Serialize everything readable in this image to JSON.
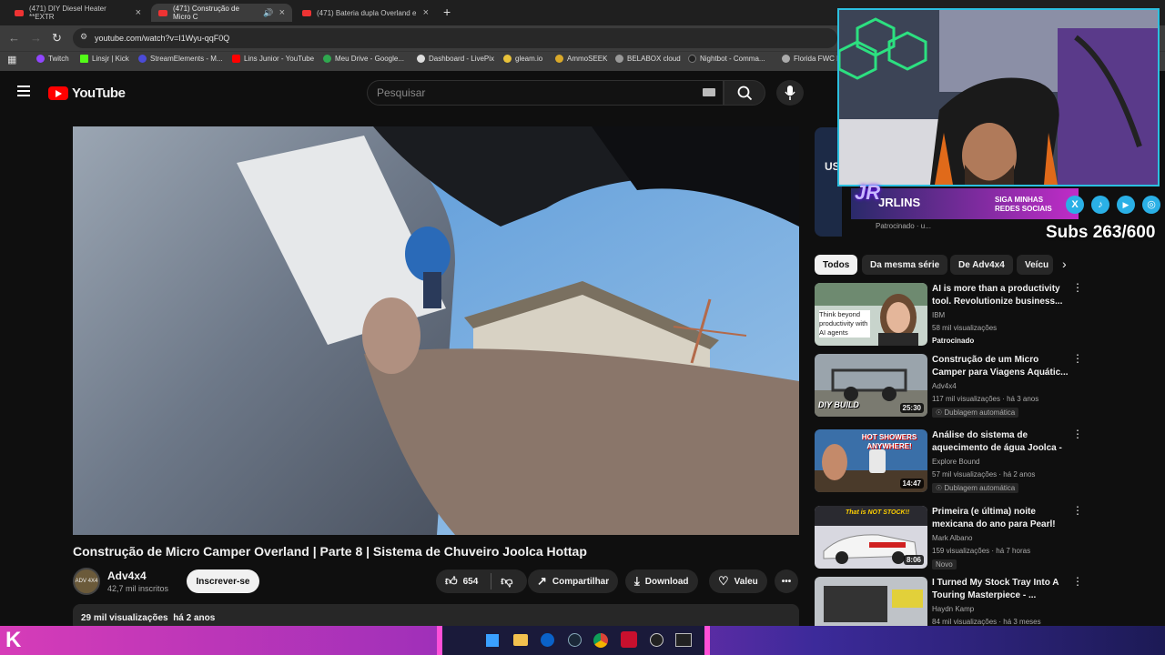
{
  "browser": {
    "tabs": [
      {
        "label": "(471) DIY Diesel Heater **EXTR",
        "active": false
      },
      {
        "label": "(471) Construção de Micro C",
        "active": true
      },
      {
        "label": "(471) Bateria dupla Overland e",
        "active": false
      }
    ],
    "new_tab": "+",
    "url": "youtube.com/watch?v=I1Wyu-qqF0Q",
    "bookmarks": [
      "Twitch",
      "Linsjr | Kick",
      "StreamElements - M...",
      "Lins Junior - YouTube",
      "Meu Drive - Google...",
      "Dashboard - LivePix",
      "gleam.io",
      "AmmoSEEK",
      "BELABOX cloud",
      "Nightbot - Comma...",
      "Florida FWC D"
    ]
  },
  "youtube": {
    "logo": "YouTube",
    "search_placeholder": "Pesquisar"
  },
  "video": {
    "title": "Construção de Micro Camper Overland | Parte 8 | Sistema de Chuveiro Joolca Hottap",
    "channel": "Adv4x4",
    "avatar_text": "ADV 4X4",
    "subscribers": "42,7 mil inscritos",
    "subscribe_label": "Inscrever-se",
    "likes": "654",
    "share_label": "Compartilhar",
    "download_label": "Download",
    "thanks_label": "Valeu",
    "views": "29 mil visualizações",
    "age": "há 2 anos"
  },
  "chips": [
    "Todos",
    "Da mesma série",
    "De Adv4x4",
    "Veícu"
  ],
  "recommendations": [
    {
      "title": "AI is more than a productivity tool. Revolutionize business...",
      "channel": "IBM",
      "meta": "58 mil visualizações",
      "badge": "Patrocinado",
      "sponsored": true,
      "duration": "",
      "thumb_text": "Think beyond productivity with AI agents",
      "thumb_color": "#c8d4cc"
    },
    {
      "title": "Construção de um Micro Camper para Viagens Aquátic...",
      "channel": "Adv4x4",
      "meta": "117 mil visualizações · há 3 anos",
      "badge": "Dublagem automática",
      "sponsored": false,
      "duration": "25:30",
      "thumb_text": "DIY BUILD",
      "thumb_color": "#9aa4ac"
    },
    {
      "title": "Análise do sistema de aquecimento de água Joolca - ...",
      "channel": "Explore Bound",
      "meta": "57 mil visualizações · há 2 anos",
      "badge": "Dublagem automática",
      "sponsored": false,
      "duration": "14:47",
      "thumb_text": "HOT SHOWERS ANYWHERE!",
      "thumb_color": "#3a6fa8"
    },
    {
      "title": "Primeira (e última) noite mexicana do ano para Pearl!",
      "channel": "Mark Albano",
      "meta": "159 visualizações · há 7 horas",
      "badge": "Novo",
      "sponsored": false,
      "duration": "8:06",
      "thumb_text": "That is NOT STOCK!!",
      "thumb_color": "#d8d8e0"
    },
    {
      "title": "I Turned My Stock Tray Into A Touring Masterpiece - ...",
      "channel": "Haydn Kamp",
      "meta": "84 mil visualizações · há 3 meses",
      "badge": "",
      "sponsored": false,
      "duration": "",
      "thumb_text": "",
      "thumb_color": "#bfc3c8"
    }
  ],
  "stream_overlay": {
    "logo": "JRLINS",
    "social": "SIGA MINHAS REDES SOCIAIS",
    "subs_goal": "Subs 263/600"
  },
  "partial_ad": {
    "text": "US",
    "sponsor": "Patrocinado · u..."
  },
  "colors": {
    "bg": "#0f0f0f",
    "brand_red": "#ff0000",
    "overlay_cyan": "#2cc0e0",
    "taskbar_magenta": "#d63cb8"
  }
}
